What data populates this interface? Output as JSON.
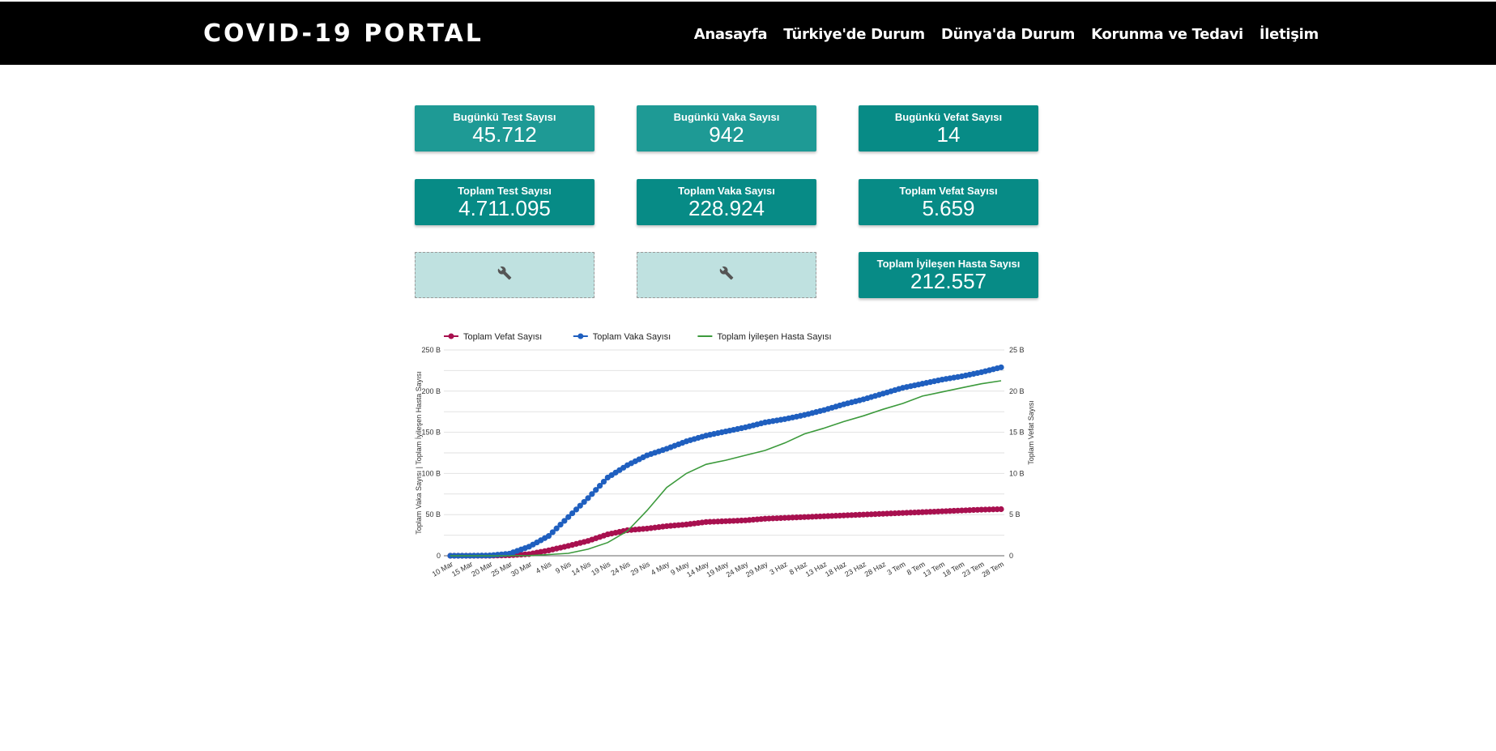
{
  "header": {
    "brand": "COVID-19 PORTAL",
    "nav": [
      "Anasayfa",
      "Türkiye'de Durum",
      "Dünya'da Durum",
      "Korunma ve Tedavi",
      "İletişim"
    ]
  },
  "cards": [
    {
      "label": "Bugünkü Test Sayısı",
      "value": "45.712"
    },
    {
      "label": "Bugünkü Vaka Sayısı",
      "value": "942"
    },
    {
      "label": "Bugünkü Vefat Sayısı",
      "value": "14"
    },
    {
      "label": "Toplam Test Sayısı",
      "value": "4.711.095"
    },
    {
      "label": "Toplam Vaka Sayısı",
      "value": "228.924"
    },
    {
      "label": "Toplam Vefat Sayısı",
      "value": "5.659"
    },
    {
      "label": "Toplam İyileşen Hasta Sayısı",
      "value": "212.557"
    }
  ],
  "placeholders": [
    {
      "icon": "wrench-icon"
    },
    {
      "icon": "wrench-icon"
    }
  ],
  "colors": {
    "navbar": "#000000",
    "card_light": "#1e9a95",
    "card_dark": "#078b86",
    "placeholder": "#bfe1e0"
  },
  "chart_data": {
    "type": "line",
    "legend_position": "top-left",
    "grid": true,
    "x": [
      "10 Mar",
      "15 Mar",
      "20 Mar",
      "25 Mar",
      "30 Mar",
      "4 Nis",
      "9 Nis",
      "14 Nis",
      "19 Nis",
      "24 Nis",
      "29 Nis",
      "4 May",
      "9 May",
      "14 May",
      "19 May",
      "24 May",
      "29 May",
      "3 Haz",
      "8 Haz",
      "13 Haz",
      "18 Haz",
      "23 Haz",
      "28 Haz",
      "3 Tem",
      "8 Tem",
      "13 Tem",
      "18 Tem",
      "23 Tem",
      "28 Tem"
    ],
    "left_axis": {
      "label": "Toplam Vaka Sayısı | Toplam İyileşen Hasta Sayısı",
      "ticks": [
        "0",
        "50 B",
        "100 B",
        "150 B",
        "200 B",
        "250 B"
      ],
      "ylim": [
        0,
        250000
      ]
    },
    "right_axis": {
      "label": "Toplam Vefat Sayısı",
      "ticks": [
        "0",
        "5 B",
        "10 B",
        "15 B",
        "20 B",
        "25 B"
      ],
      "ylim": [
        0,
        25000
      ]
    },
    "series": [
      {
        "name": "Toplam Vefat Sayısı",
        "axis": "right",
        "color": "#a8104f",
        "markers": true,
        "values": [
          0,
          0,
          10,
          60,
          200,
          650,
          1200,
          1800,
          2600,
          3100,
          3300,
          3600,
          3800,
          4100,
          4200,
          4300,
          4500,
          4600,
          4700,
          4800,
          4900,
          5000,
          5100,
          5200,
          5300,
          5400,
          5500,
          5600,
          5659
        ]
      },
      {
        "name": "Toplam Vaka Sayısı",
        "axis": "left",
        "color": "#1f5fbf",
        "markers": true,
        "values": [
          0,
          50,
          350,
          2500,
          11000,
          24000,
          47000,
          70000,
          95000,
          110000,
          122000,
          130000,
          139000,
          146000,
          151000,
          156000,
          162000,
          166000,
          171000,
          177000,
          184000,
          190000,
          197000,
          204000,
          209000,
          214000,
          218000,
          223000,
          228924
        ]
      },
      {
        "name": "Toplam İyileşen Hasta Sayısı",
        "axis": "left",
        "color": "#3c9a3c",
        "markers": false,
        "values": [
          0,
          0,
          0,
          0,
          200,
          1500,
          3000,
          8000,
          16000,
          30000,
          55000,
          83000,
          100000,
          111000,
          116000,
          122000,
          128000,
          137000,
          148000,
          155000,
          163000,
          170000,
          178000,
          185000,
          194000,
          199000,
          204000,
          209000,
          212557
        ]
      }
    ]
  }
}
